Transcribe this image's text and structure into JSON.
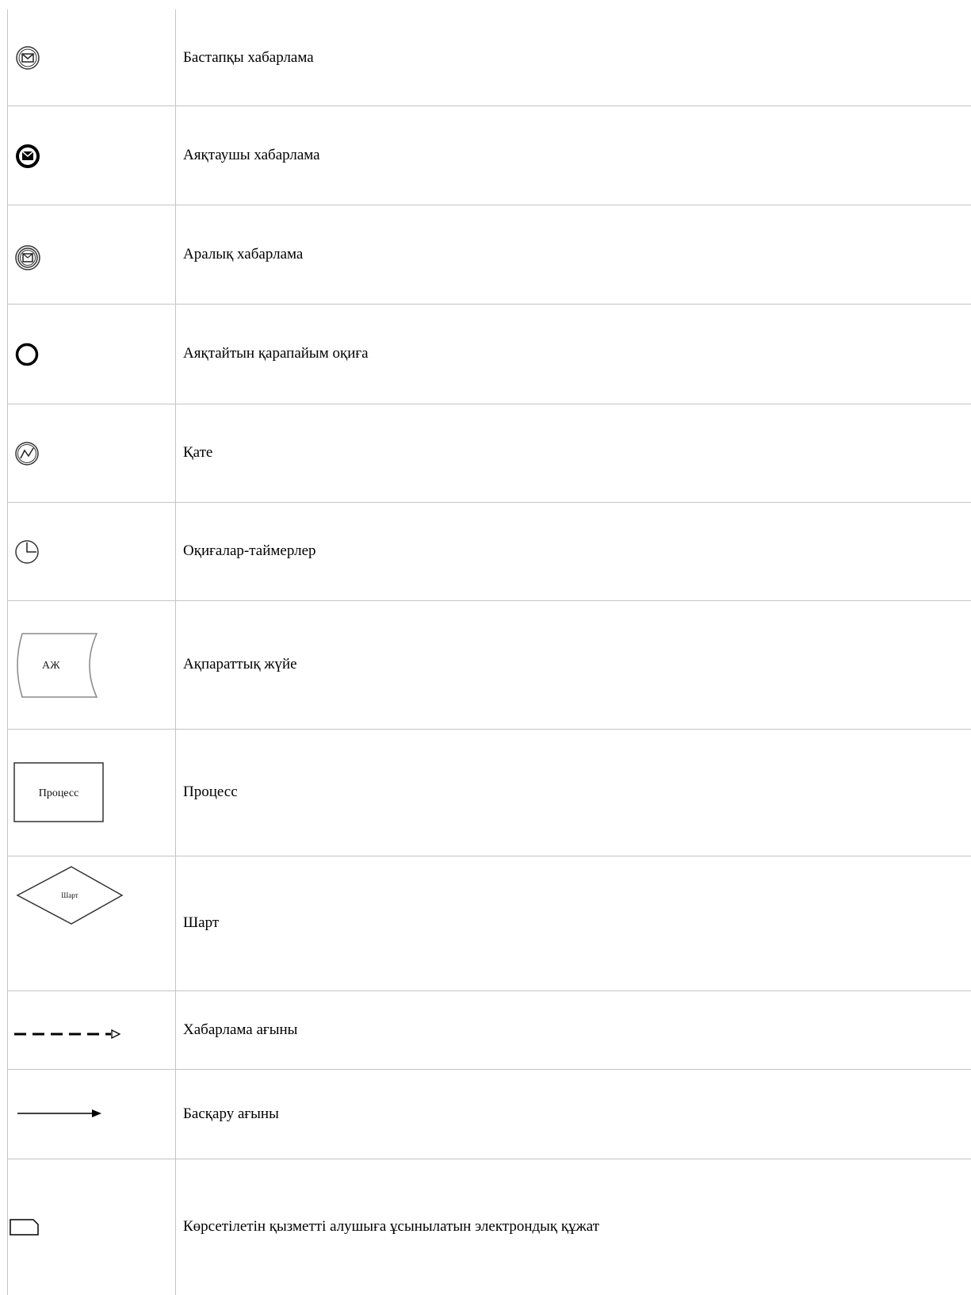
{
  "legend": {
    "rows": [
      {
        "icon": "start-message-event-icon",
        "label": "Бастапқы хабарлама"
      },
      {
        "icon": "end-message-event-icon",
        "label": "Аяқтаушы хабарлама"
      },
      {
        "icon": "intermediate-message-event-icon",
        "label": "Аралық хабарлама"
      },
      {
        "icon": "simple-end-event-icon",
        "label": "Аяқтайтын қарапайым оқиға"
      },
      {
        "icon": "error-event-icon",
        "label": "Қате"
      },
      {
        "icon": "timer-event-icon",
        "label": "Оқиғалар-таймерлер"
      },
      {
        "icon": "information-system-icon",
        "label": "Ақпараттық жүйе",
        "icon_text": "АЖ"
      },
      {
        "icon": "process-icon",
        "label": "Процесс",
        "icon_text": "Процесс"
      },
      {
        "icon": "condition-icon",
        "label": "Шарт",
        "icon_text": "Шарт"
      },
      {
        "icon": "message-flow-icon",
        "label": "Хабарлама ағыны"
      },
      {
        "icon": "control-flow-icon",
        "label": "Басқару ағыны"
      },
      {
        "icon": "electronic-document-icon",
        "label": "Көрсетілетін қызметті алушыға ұсынылатын электрондық құжат"
      }
    ]
  }
}
